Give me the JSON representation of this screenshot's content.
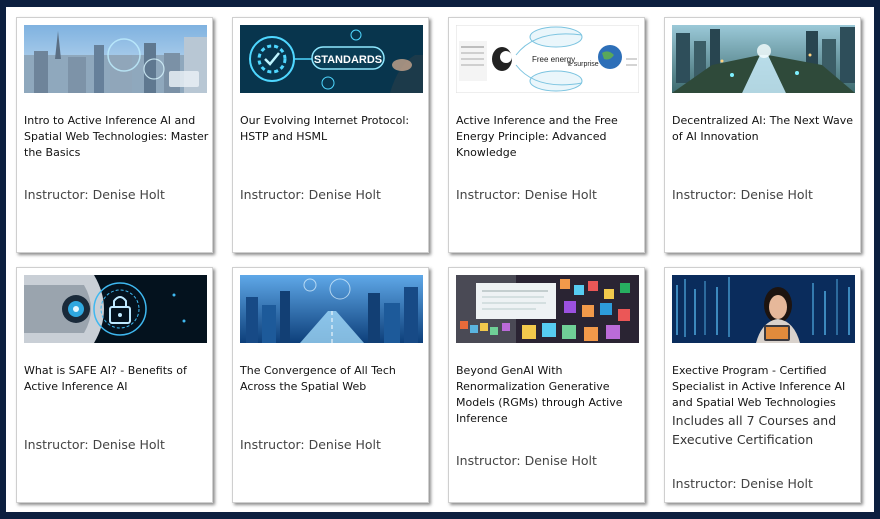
{
  "courses": [
    {
      "title": "Intro to Active Inference AI and Spatial Web Technologies: Master the Basics",
      "instructor": "Instructor: Denise Holt",
      "image": "city-skyline-holographic-image"
    },
    {
      "title": "Our Evolving Internet Protocol: HSTP and HSML",
      "instructor": "Instructor: Denise Holt",
      "image": "standards-gear-image",
      "image_text": "STANDARDS"
    },
    {
      "title": "Active Inference and the Free Energy Principle: Advanced Knowledge",
      "instructor": "Instructor: Denise Holt",
      "image": "free-energy-diagram-image",
      "image_text": "Free energy",
      "image_text2": "≥ surprise"
    },
    {
      "title": "Decentralized AI: The Next Wave of AI Innovation",
      "instructor": "Instructor: Denise Holt",
      "image": "futuristic-city-street-image"
    },
    {
      "title": "What is SAFE AI? - Benefits of Active Inference AI",
      "instructor": "Instructor: Denise Holt",
      "image": "robot-eye-lock-image"
    },
    {
      "title": "The Convergence of All Tech Across the Spatial Web",
      "instructor": "Instructor: Denise Holt",
      "image": "blue-digital-city-image"
    },
    {
      "title": "Beyond GenAI With Renormalization Generative Models (RGMs) through Active Inference",
      "instructor": "Instructor: Denise Holt",
      "image": "colorful-data-mosaic-image"
    },
    {
      "title": "Exective Program - Certified Specialist in Active Inference AI and Spatial Web Technologies",
      "extra": "Includes all 7 Courses and Executive Certification",
      "instructor": "Instructor: Denise Holt",
      "image": "woman-with-tablet-image"
    }
  ]
}
